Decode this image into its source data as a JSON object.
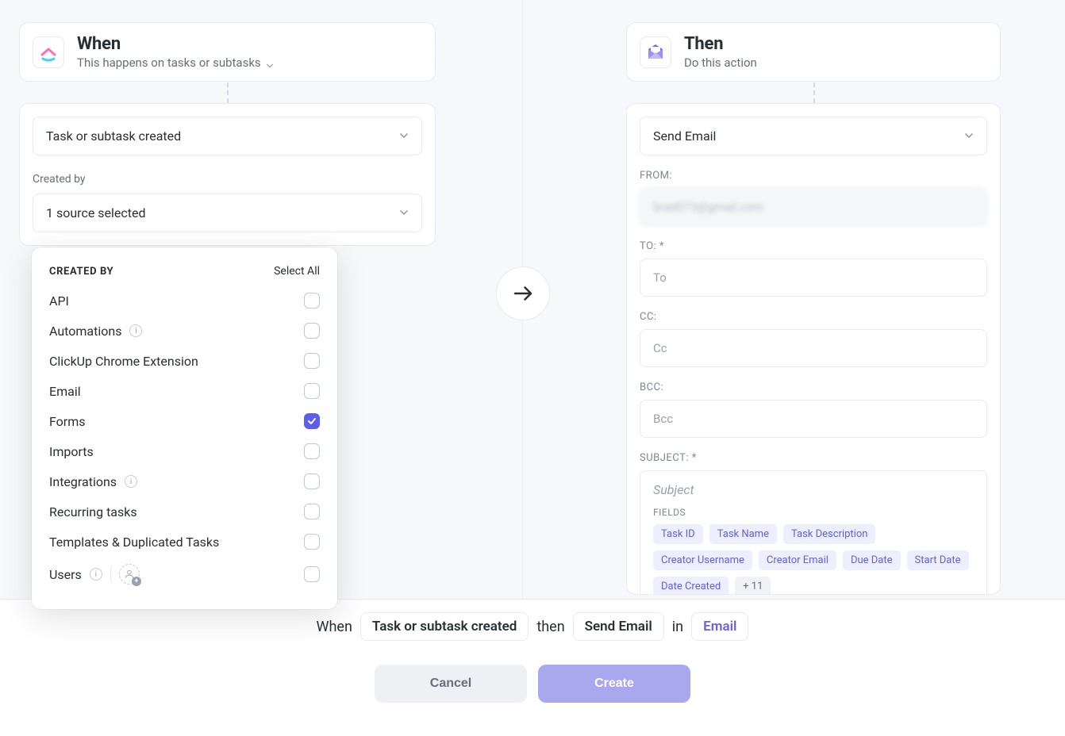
{
  "when": {
    "title": "When",
    "subtitle": "This happens on tasks or subtasks",
    "trigger": "Task or subtask created",
    "created_by_label": "Created by",
    "source_summary": "1 source selected"
  },
  "popover": {
    "title": "CREATED BY",
    "select_all": "Select All",
    "options": [
      {
        "label": "API",
        "checked": false,
        "info": false
      },
      {
        "label": "Automations",
        "checked": false,
        "info": true
      },
      {
        "label": "ClickUp Chrome Extension",
        "checked": false,
        "info": false
      },
      {
        "label": "Email",
        "checked": false,
        "info": false
      },
      {
        "label": "Forms",
        "checked": true,
        "info": false
      },
      {
        "label": "Imports",
        "checked": false,
        "info": false
      },
      {
        "label": "Integrations",
        "checked": false,
        "info": true
      },
      {
        "label": "Recurring tasks",
        "checked": false,
        "info": false
      },
      {
        "label": "Templates & Duplicated Tasks",
        "checked": false,
        "info": false
      },
      {
        "label": "Users",
        "checked": false,
        "info": true,
        "users_glyph": true
      }
    ]
  },
  "then": {
    "title": "Then",
    "subtitle": "Do this action",
    "action": "Send Email",
    "from_label": "FROM:",
    "from_value": "brad073@gmail.com",
    "to_label": "TO: *",
    "to_placeholder": "To",
    "cc_label": "CC:",
    "cc_placeholder": "Cc",
    "bcc_label": "BCC:",
    "bcc_placeholder": "Bcc",
    "subject_label": "SUBJECT: *",
    "subject_placeholder": "Subject",
    "fields_title": "FIELDS",
    "fields": [
      "Task ID",
      "Task Name",
      "Task Description",
      "Creator Username",
      "Creator Email",
      "Due Date",
      "Start Date",
      "Date Created"
    ],
    "fields_more": "+ 11"
  },
  "summary": {
    "when_word": "When",
    "trigger": "Task or subtask created",
    "then_word": "then",
    "action": "Send Email",
    "in_word": "in",
    "location": "Email"
  },
  "buttons": {
    "cancel": "Cancel",
    "create": "Create"
  },
  "icons": {
    "info_char": "i"
  }
}
